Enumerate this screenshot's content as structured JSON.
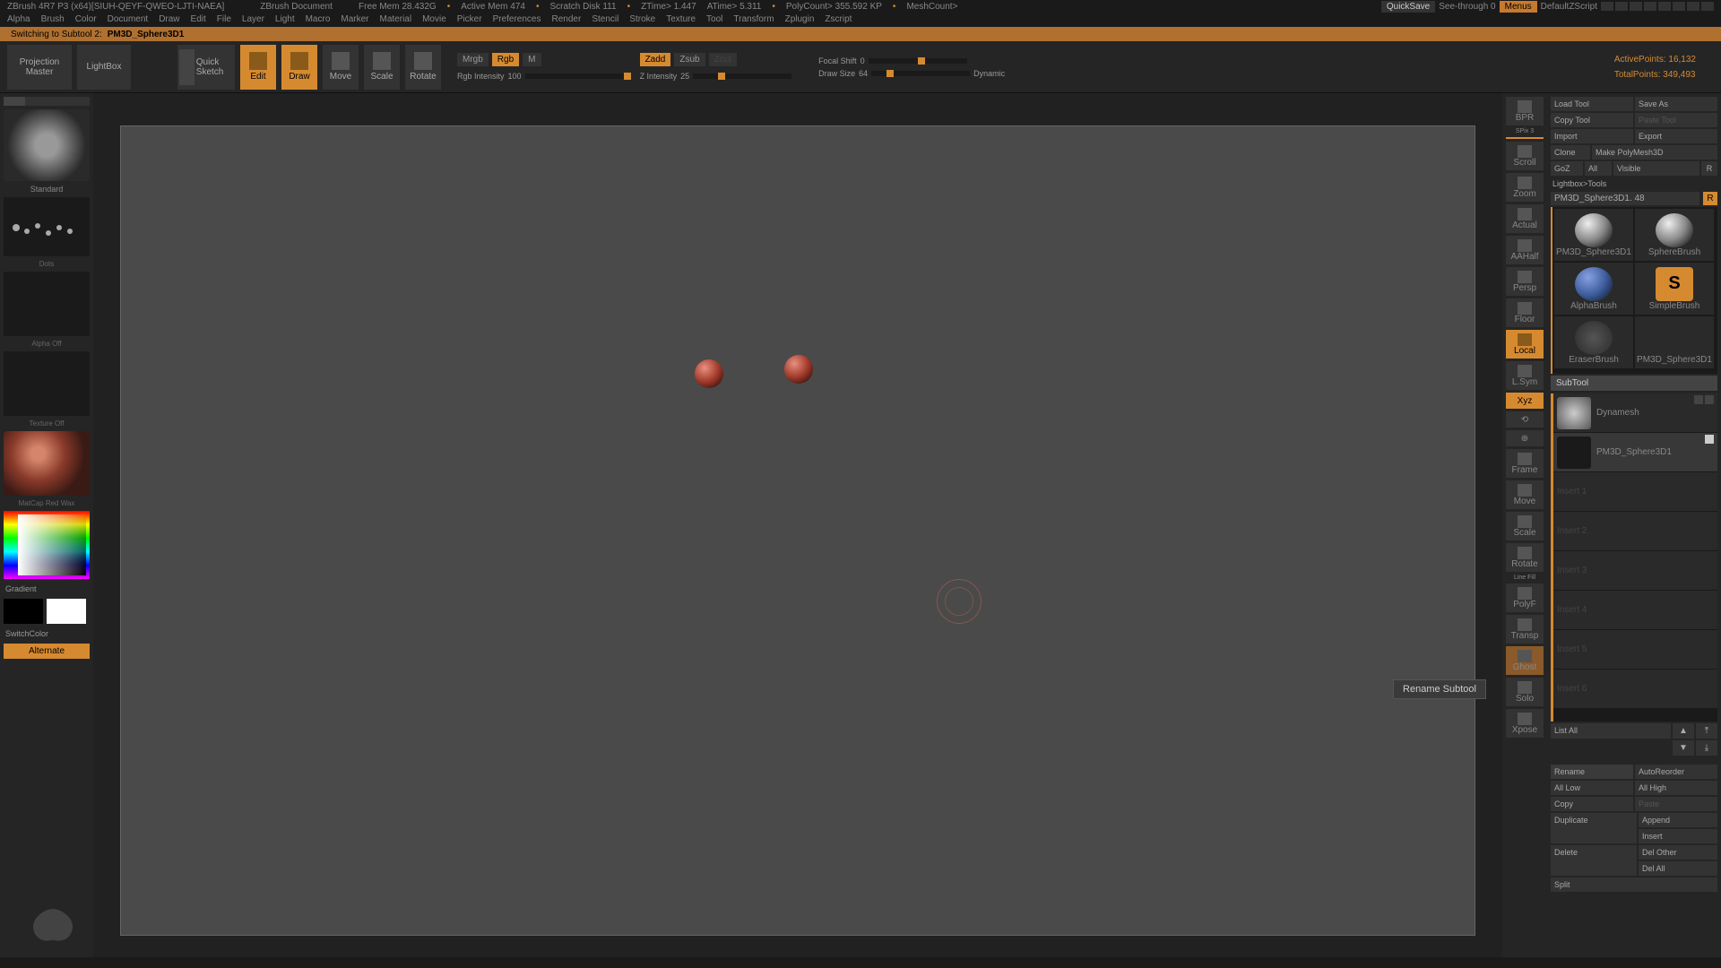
{
  "titlebar": {
    "app": "ZBrush 4R7 P3 (x64)[SIUH-QEYF-QWEO-LJTI-NAEA]",
    "doc": "ZBrush Document",
    "stats": {
      "freemem": "Free Mem 28.432G",
      "activemem": "Active Mem 474",
      "scratch": "Scratch Disk 111",
      "ztime": "ZTime> 1.447",
      "atime": "ATime> 5.311",
      "polycount": "PolyCount> 355.592 KP",
      "meshcount": "MeshCount>"
    },
    "quicksave": "QuickSave",
    "seethrough": "See-through  0",
    "menus": "Menus",
    "script": "DefaultZScript"
  },
  "menubar": [
    "Alpha",
    "Brush",
    "Color",
    "Document",
    "Draw",
    "Edit",
    "File",
    "Layer",
    "Light",
    "Macro",
    "Marker",
    "Material",
    "Movie",
    "Picker",
    "Preferences",
    "Render",
    "Stencil",
    "Stroke",
    "Texture",
    "Tool",
    "Transform",
    "Zplugin",
    "Zscript"
  ],
  "statusline": {
    "prefix": "Switching to Subtool 2:",
    "name": "PM3D_Sphere3D1"
  },
  "toolbar": {
    "projection": "Projection Master",
    "lightbox": "LightBox",
    "quicksketch": "Quick Sketch",
    "edit": "Edit",
    "draw": "Draw",
    "move": "Move",
    "scale": "Scale",
    "rotate": "Rotate",
    "mrgb": "Mrgb",
    "rgb": "Rgb",
    "m": "M",
    "rgb_intensity_label": "Rgb Intensity",
    "rgb_intensity": "100",
    "zadd": "Zadd",
    "zsub": "Zsub",
    "zcut": "Zcut",
    "z_intensity_label": "Z Intensity",
    "z_intensity": "25",
    "focal_label": "Focal Shift",
    "focal": "0",
    "drawsize_label": "Draw Size",
    "drawsize": "64",
    "dynamic": "Dynamic",
    "activepoints_label": "ActivePoints:",
    "activepoints": "16,132",
    "totalpoints_label": "TotalPoints:",
    "totalpoints": "349,493"
  },
  "left": {
    "brush": "Standard",
    "stroke": "Dots",
    "alpha": "Alpha Off",
    "texture": "Texture Off",
    "material": "MatCap Red Wax",
    "gradient": "Gradient",
    "switchcolor": "SwitchColor",
    "alternate": "Alternate"
  },
  "right_toolbar": {
    "bpr": "BPR",
    "spix": "SPix 3",
    "scroll": "Scroll",
    "zoom": "Zoom",
    "actual": "Actual",
    "aahalf": "AAHalf",
    "persp": "Persp",
    "floor": "Floor",
    "local": "Local",
    "lsym": "L.Sym",
    "xyz": "Xyz",
    "frame": "Frame",
    "move": "Move",
    "scale": "Scale",
    "rotate": "Rotate",
    "linefill": "Line Fill",
    "polyf": "PolyF",
    "transp": "Transp",
    "ghost": "Ghost",
    "solo": "Solo",
    "xpose": "Xpose"
  },
  "tooltip": "Rename Subtool",
  "right_panel": {
    "load_tool": "Load Tool",
    "save_as": "Save As",
    "copy_tool": "Copy Tool",
    "paste_tool": "Paste Tool",
    "import": "Import",
    "export": "Export",
    "clone": "Clone",
    "make_polymesh": "Make PolyMesh3D",
    "goz": "GoZ",
    "all": "All",
    "visible": "Visible",
    "r": "R",
    "lightbox_tools": "Lightbox>Tools",
    "tool_name": "PM3D_Sphere3D1. 48",
    "tools": [
      "PM3D_Sphere3D1",
      "SphereBrush",
      "AlphaBrush",
      "SimpleBrush",
      "EraserBrush",
      "PM3D_Sphere3D1"
    ],
    "subtool_header": "SubTool",
    "subtool_items": [
      {
        "name": "Dynamesh"
      },
      {
        "name": "PM3D_Sphere3D1"
      }
    ],
    "empty_slots": [
      "Insert 1",
      "Insert 2",
      "Insert 3",
      "Insert 4",
      "Insert 5",
      "Insert 6"
    ],
    "list_all": "List All",
    "rename": "Rename",
    "autoreorder": "AutoReorder",
    "all_low": "All Low",
    "all_high": "All High",
    "copy": "Copy",
    "paste": "Paste",
    "duplicate": "Duplicate",
    "append": "Append",
    "insert": "Insert",
    "delete": "Delete",
    "del_other": "Del Other",
    "del_all": "Del All",
    "split": "Split"
  }
}
